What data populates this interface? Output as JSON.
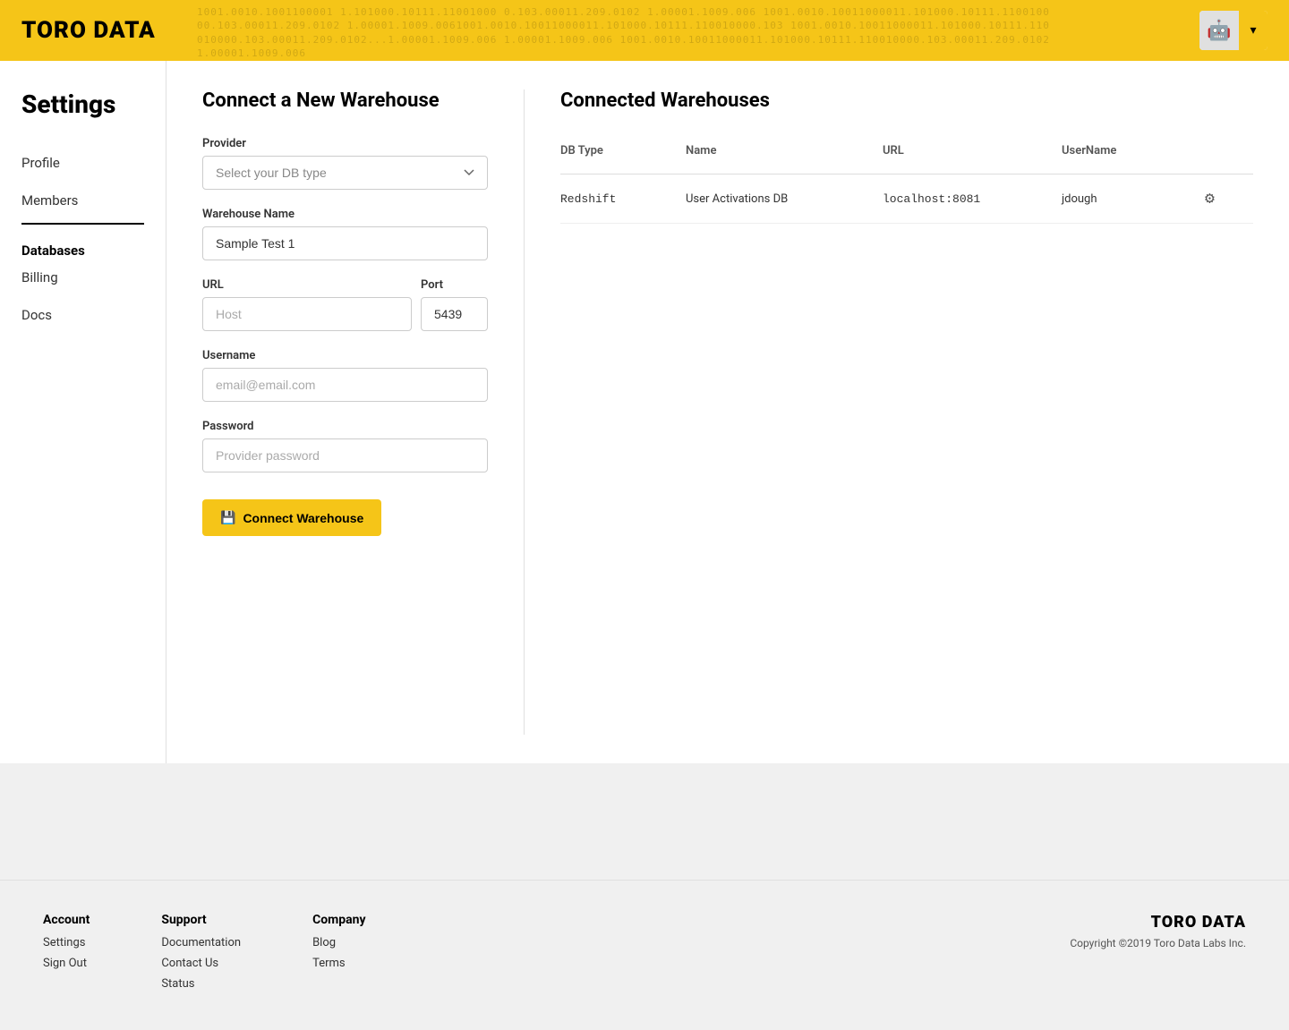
{
  "header": {
    "logo": "TORO DATA",
    "binary_text": "1001.0010.10011000011.101000.10111.110010000.103.00011.209.0102...1.00001.1009.006...",
    "avatar_emoji": "🤖",
    "chevron": "▾"
  },
  "sidebar": {
    "title": "Settings",
    "items": [
      {
        "label": "Profile",
        "active": false
      },
      {
        "label": "Members",
        "active": false
      }
    ],
    "section_label": "Databases",
    "sub_items": [
      {
        "label": "Billing"
      },
      {
        "label": "Docs"
      }
    ]
  },
  "connect_form": {
    "title": "Connect a New Warehouse",
    "provider_label": "Provider",
    "provider_placeholder": "Select your DB type",
    "warehouse_name_label": "Warehouse Name",
    "warehouse_name_value": "Sample Test 1",
    "url_label": "URL",
    "url_placeholder": "Host",
    "port_label": "Port",
    "port_value": "5439",
    "username_label": "Username",
    "username_placeholder": "email@email.com",
    "password_label": "Password",
    "password_placeholder": "Provider password",
    "button_label": "Connect Warehouse",
    "button_icon": "💾"
  },
  "connected_warehouses": {
    "title": "Connected Warehouses",
    "columns": [
      "DB Type",
      "Name",
      "URL",
      "UserName"
    ],
    "rows": [
      {
        "db_type": "Redshift",
        "name": "User Activations DB",
        "url": "localhost:8081",
        "username": "jdough"
      }
    ]
  },
  "footer": {
    "account": {
      "title": "Account",
      "links": [
        "Settings",
        "Sign Out"
      ]
    },
    "support": {
      "title": "Support",
      "links": [
        "Documentation",
        "Contact Us",
        "Status"
      ]
    },
    "company": {
      "title": "Company",
      "links": [
        "Blog",
        "Terms"
      ]
    },
    "brand": "TORO DATA",
    "copyright": "Copyright ©2019 Toro Data Labs Inc."
  }
}
